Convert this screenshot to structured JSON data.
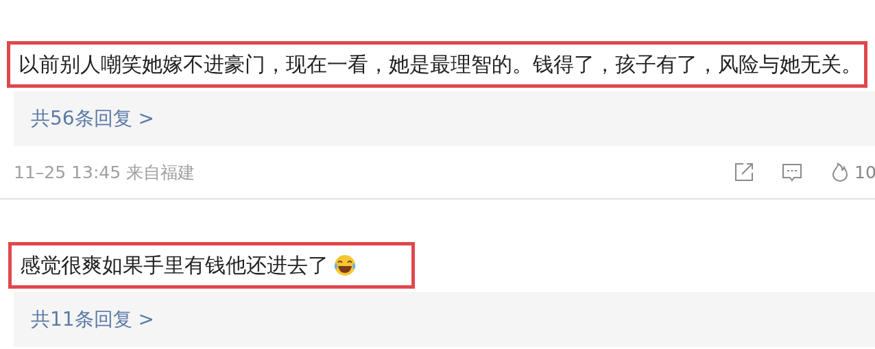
{
  "comments": [
    {
      "kind": "plain",
      "text": "以前别人嘲笑她嫁不进豪门，现在一看，她是最理智的。钱得了，孩子有了，风险与她无关。",
      "replies": "共56条回复 >",
      "meta": {
        "time": "11–25 13:45 来自福建",
        "likes": "10"
      }
    },
    {
      "kind": "emoji",
      "text": "感觉很爽如果手里有钱他还进去了",
      "replies": "共11条回复 >"
    }
  ]
}
